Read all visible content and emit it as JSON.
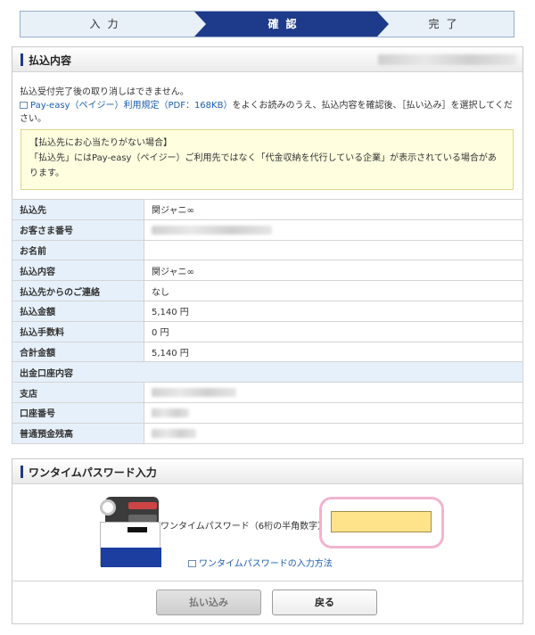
{
  "steps": {
    "input": "入力",
    "confirm": "確認",
    "complete": "完了"
  },
  "payment_panel": {
    "title": "払込内容",
    "notice_line1": "払込受付完了後の取り消しはできません。",
    "notice_link": "Pay-easy（ペイジー）利用規定（PDF：168KB）",
    "notice_line2": "をよくお読みのうえ、払込内容を確認後、［払い込み］を選択してください。",
    "warn_title": "【払込先にお心当たりがない場合】",
    "warn_text": "「払込先」にはPay-easy（ペイジー）ご利用先ではなく「代金収納を代行している企業」が表示されている場合があります。"
  },
  "details": {
    "payee_label": "払込先",
    "payee_value": "関ジャニ∞",
    "customer_no_label": "お客さま番号",
    "name_label": "お名前",
    "name_value": "",
    "content_label": "払込内容",
    "content_value": "関ジャニ∞",
    "contact_label": "払込先からのご連絡",
    "contact_value": "なし",
    "amount_label": "払込金額",
    "amount_value": "5,140 円",
    "fee_label": "払込手数料",
    "fee_value": "0 円",
    "total_label": "合計金額",
    "total_value": "5,140 円",
    "account_section": "出金口座内容",
    "branch_label": "支店",
    "account_no_label": "口座番号",
    "balance_label": "普通預金残高"
  },
  "otp": {
    "title": "ワンタイムパスワード入力",
    "input_label": "ワンタイムパスワード（6桁の半角数字）",
    "input_value": "",
    "help_link": "ワンタイムパスワードの入力方法",
    "pay_button": "払い込み",
    "back_button": "戻る"
  },
  "colors": {
    "accent": "#1e3a8a",
    "input_bg": "#ffe38a",
    "highlight": "#f2b3d0"
  }
}
